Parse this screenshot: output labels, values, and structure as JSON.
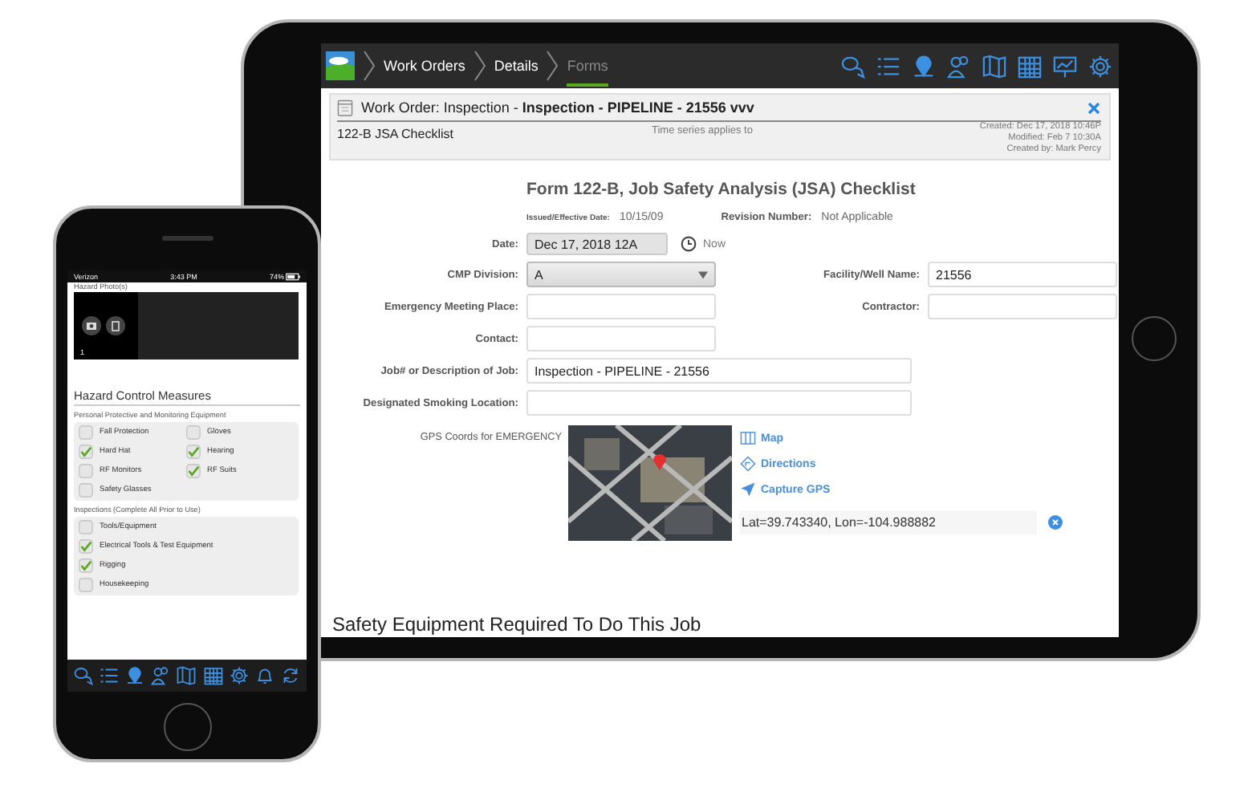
{
  "tablet": {
    "breadcrumbs": [
      {
        "label": "Work Orders",
        "selected": false
      },
      {
        "label": "Details",
        "selected": false
      },
      {
        "label": "Forms",
        "selected": true
      }
    ],
    "work_order": {
      "title": "Work Order: Inspection - **Inspection - PIPELINE - 21556 vvv**",
      "form_name": "122-B JSA Checklist",
      "note": "Time series applies to",
      "meta": [
        "Created: Dec 17, 2018 10:46P",
        "Modified: Feb 7 10:30A",
        "Created by: Mark Percy"
      ]
    },
    "form": {
      "title": "Form 122-B, Job Safety Analysis (JSA) Checklist",
      "issued_label": "Issued/Effective Date:",
      "issued": "10/15/09",
      "revision_label": "Revision Number:",
      "revision": "Not Applicable",
      "date": {
        "label": "Date:",
        "value": "Dec 17, 2018 12A",
        "now": "Now"
      },
      "rows": [
        [
          {
            "label": "CMP Division:",
            "value": "A",
            "kind": "select"
          },
          {
            "label": "Facility/Well Name:",
            "value": "21556",
            "kind": "text"
          }
        ],
        [
          {
            "label": "Emergency Meeting Place:",
            "kind": "text"
          },
          {
            "label": "Contractor:",
            "kind": "text"
          }
        ],
        [
          {
            "label": "Contact:",
            "kind": "text"
          }
        ],
        [
          {
            "label": "Job# or Description of Job:",
            "value": "Inspection - PIPELINE - 21556",
            "kind": "long"
          }
        ],
        [
          {
            "label": "Designated Smoking Location:",
            "kind": "long"
          }
        ]
      ],
      "gps": {
        "label": "GPS Coords for EMERGENCY",
        "actions": [
          {
            "label": "Map",
            "kind": "map"
          },
          {
            "label": "Directions",
            "kind": "directions"
          },
          {
            "label": "Capture GPS",
            "kind": "capture"
          }
        ],
        "coords": "Lat=39.743340, Lon=-104.988882"
      },
      "section_heading": "Safety Equipment Required To Do This Job"
    }
  },
  "phone": {
    "status": {
      "carrier": "Verizon",
      "time": "3:43 PM",
      "battery": "74%"
    },
    "photos_label": "Hazard Photo(s)",
    "photo_count": "1",
    "heading": "Hazard Control Measures",
    "groups": [
      {
        "title": "Personal Protective and Monitoring Equipment",
        "kind": "grid",
        "items": [
          {
            "label": "Fall Protection",
            "checked": false
          },
          {
            "label": "Gloves",
            "checked": false
          },
          {
            "label": "Hard Hat",
            "checked": true
          },
          {
            "label": "Hearing",
            "checked": true
          },
          {
            "label": "RF Monitors",
            "checked": false
          },
          {
            "label": "RF Suits",
            "checked": true
          },
          {
            "label": "Safety Glasses",
            "checked": false
          }
        ]
      },
      {
        "title": "Inspections (Complete All Prior to Use)",
        "kind": "list",
        "items": [
          {
            "label": "Tools/Equipment",
            "checked": false
          },
          {
            "label": "Electrical Tools & Test Equipment",
            "checked": true
          },
          {
            "label": "Rigging",
            "checked": true
          },
          {
            "label": "Housekeeping",
            "checked": false
          }
        ]
      }
    ]
  }
}
